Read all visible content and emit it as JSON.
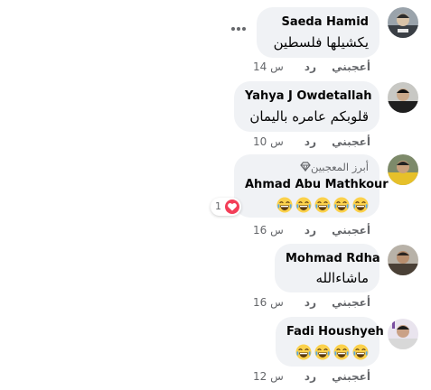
{
  "action_labels": {
    "like": "أعجبني",
    "reply": "رد"
  },
  "comments": [
    {
      "author": "Saeda Hamid",
      "text": "يكشيلها فلسطين",
      "time": "14 س",
      "avatar_icon": "profile-photo",
      "has_more_menu": true
    },
    {
      "author": "Yahya J Owdetallah",
      "text": "قلوبكم عامره باليمان",
      "time": "10 س",
      "avatar_icon": "profile-photo"
    },
    {
      "author": "Ahmad Abu Mathkour",
      "badge": "أبرز المعجبين",
      "badge_icon": "diamond-icon",
      "emoji_icon": "laughing-face-emoji",
      "emoji_count": 5,
      "reaction_icon": "heart-reaction-icon",
      "reaction_count": "1",
      "time": "16 س",
      "avatar_icon": "profile-photo"
    },
    {
      "author": "Mohmad Rdha",
      "text": "ماشاءالله",
      "time": "16 س",
      "avatar_icon": "profile-photo"
    },
    {
      "author": "Fadi Houshyeh",
      "emoji_icon": "laughing-face-emoji",
      "emoji_count": 4,
      "time": "12 س",
      "avatar_icon": "profile-photo"
    }
  ],
  "colors": {
    "bubble": "#f0f2f5",
    "text": "#050505",
    "muted": "#65676b",
    "heart": "#f33e58",
    "emoji": "#fbd14b"
  }
}
